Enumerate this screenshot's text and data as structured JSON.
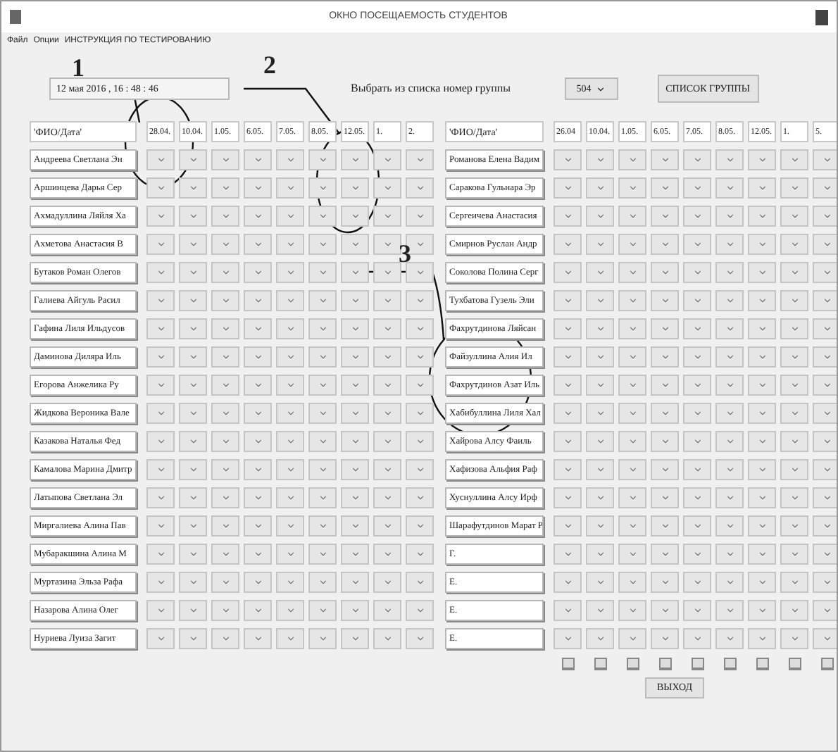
{
  "window": {
    "title": "ОКНО ПОСЕЩАЕМОСТЬ СТУДЕНТОВ"
  },
  "menu": [
    "Файл",
    "Опции",
    "ИНСТРУКЦИЯ ПО ТЕСТИРОВАНИЮ"
  ],
  "datetime": "12 мая 2016 , 16 : 48 : 46",
  "group_prompt": "Выбрать из списка номер группы",
  "group_select": {
    "value": "504"
  },
  "group_list_button": "СПИСОК ГРУППЫ",
  "exit_button": "ВЫХОД",
  "tables": [
    {
      "name_header": "'ФИО/Дата'",
      "dates": [
        "28.04.",
        "10.04.",
        "1.05.",
        "6.05.",
        "7.05.",
        "8.05.",
        "12.05.",
        "1.",
        "2."
      ],
      "footer_buttons": false,
      "names": [
        "Андреева Светлана Эн",
        "Аршинцева Дарья Сер",
        "Ахмадуллина Ляйля Ха",
        "Ахметова Анастасия В",
        "Бутаков Роман Олегов",
        "Галиева Айгуль Расил",
        "Гафина Лиля Ильдусов",
        "Даминова Диляра Иль",
        "Егорова Анжелика Ру",
        "Жидкова Вероника Вале",
        "Казакова Наталья Фед",
        "Камалова Марина Дмитр",
        "Латыпова Светлана Эл",
        "Миргалиева Алина Пав",
        "Мубаракшина Алина М",
        "Муртазина Эльза Рафа",
        "Назарова Алина Олег",
        "Нуриева Луиза Загит"
      ]
    },
    {
      "name_header": "'ФИО/Дата'",
      "dates": [
        "26.04",
        "10.04.",
        "1.05.",
        "6.05.",
        "7.05.",
        "8.05.",
        "12.05.",
        "1.",
        "5."
      ],
      "footer_buttons": true,
      "names": [
        "Романова Елена Вадим",
        "Саракова Гульнара Эр",
        "Сергеичева Анастасия",
        "Смирнов Руслан Андр",
        "Соколова Полина Серг",
        "Тухбатова Гузель Эли",
        "Фахрутдинова Ляйсан",
        "Файзуллина Алия Ил",
        "Фахрутдинов Азат Иль",
        "Хабибуллина Лиля Хал",
        "Хайрова Алсу Фаиль",
        "Хафизова Альфия Раф",
        "Хуснуллина Алсу Ирф",
        "Шарафутдинов Марат Р",
        "Г.",
        "Е.",
        "Е.",
        "Е."
      ]
    }
  ],
  "annotations": [
    {
      "label": "1"
    },
    {
      "label": "2"
    },
    {
      "label": "3"
    }
  ]
}
